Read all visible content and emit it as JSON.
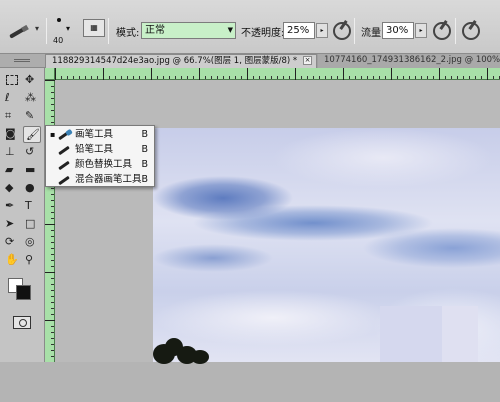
{
  "options": {
    "brush_size": "40",
    "mode_label": "模式:",
    "mode_value": "正常",
    "opacity_label": "不透明度:",
    "opacity_value": "25%",
    "flow_label": "流量:",
    "flow_value": "30%",
    "accent_green": "#c8f0c8"
  },
  "tabs": [
    {
      "label": "118829314547d24e3ao.jpg @ 66.7%(图层 1, 图层蒙版/8) *",
      "close": "×"
    },
    {
      "label": "10774160_174931386162_2.jpg @ 100% (图层",
      "close": ""
    }
  ],
  "flyout": {
    "items": [
      {
        "label": "画笔工具",
        "key": "B",
        "bullet": "▪",
        "icon": "brush-icon"
      },
      {
        "label": "铅笔工具",
        "key": "B",
        "bullet": "",
        "icon": "pencil-icon"
      },
      {
        "label": "颜色替换工具",
        "key": "B",
        "bullet": "",
        "icon": "color-replacement-icon"
      },
      {
        "label": "混合器画笔工具",
        "key": "B",
        "bullet": "",
        "icon": "mixer-brush-icon"
      }
    ]
  },
  "tools": {
    "type_glyph": "T",
    "foreground": "#ffffff",
    "background": "#111111"
  }
}
